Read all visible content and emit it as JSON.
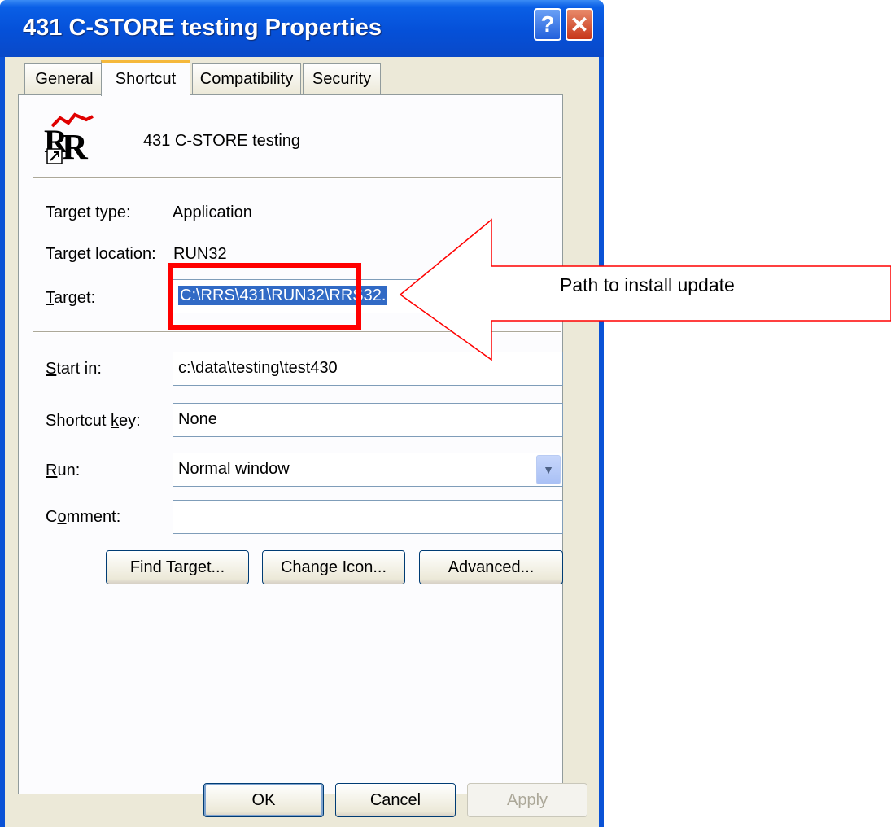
{
  "window": {
    "title": "431 C-STORE testing Properties",
    "help_label": "?",
    "close_label": "✕"
  },
  "tabs": [
    {
      "label": "General"
    },
    {
      "label": "Shortcut",
      "active": true
    },
    {
      "label": "Compatibility"
    },
    {
      "label": "Security"
    }
  ],
  "shortcut": {
    "name": "431 C-STORE testing",
    "icon": "rr-app-shortcut-icon",
    "target_type_label": "Target type:",
    "target_type_value": "Application",
    "target_location_label": "Target location:",
    "target_location_value": "RUN32",
    "target_label": "Target:",
    "target_value": "C:\\RRS\\431\\RUN32\\RRS32.",
    "start_in_label": "Start in:",
    "start_in_value": "c:\\data\\testing\\test430",
    "shortcut_key_label": "Shortcut key:",
    "shortcut_key_value": "None",
    "run_label": "Run:",
    "run_value": "Normal window",
    "comment_label": "Comment:",
    "comment_value": "",
    "find_target_label": "Find Target...",
    "change_icon_label": "Change Icon...",
    "advanced_label": "Advanced..."
  },
  "footer": {
    "ok_label": "OK",
    "cancel_label": "Cancel",
    "apply_label": "Apply"
  },
  "annotation": {
    "text": "Path to install update",
    "arrow_color": "#ff0000",
    "box_color": "#ff0000"
  }
}
